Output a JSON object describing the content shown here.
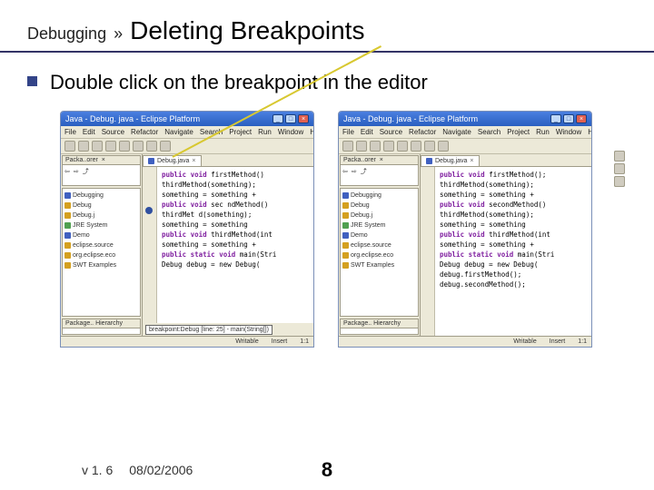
{
  "breadcrumb": "Debugging",
  "separator": "»",
  "title": "Deleting Breakpoints",
  "bullet": "Double click on the breakpoint in the editor",
  "footer": {
    "version": "v 1. 6",
    "date": "08/02/2006",
    "page": "8"
  },
  "ide": {
    "window_title": "Java - Debug. java - Eclipse Platform",
    "menus": [
      "File",
      "Edit",
      "Source",
      "Refactor",
      "Navigate",
      "Search",
      "Project",
      "Run",
      "Window",
      "Help"
    ],
    "left_tab_a": "Packa..orer",
    "editor_tab": "Debug.java",
    "editor_x": "×",
    "tree": [
      {
        "icon": "blue",
        "label": "Debugging"
      },
      {
        "icon": "",
        "label": "Debug"
      },
      {
        "icon": "",
        "label": "Debug.j"
      },
      {
        "icon": "green",
        "label": "JRE System"
      },
      {
        "icon": "blue",
        "label": "Demo"
      },
      {
        "icon": "",
        "label": "eclipse.source"
      },
      {
        "icon": "",
        "label": "org.eclipse.eco"
      },
      {
        "icon": "",
        "label": "SWT Examples"
      }
    ],
    "code_before": [
      [
        "public void",
        " firstMethod()"
      ],
      [
        "",
        "    thirdMethod(something);"
      ],
      [
        "",
        "    something = something +"
      ],
      [
        "",
        ""
      ],
      [
        "public void",
        " sec  ndMethod()"
      ],
      [
        "",
        "    thirdMet  d(something);"
      ],
      [
        "",
        "    something = something "
      ],
      [
        "",
        ""
      ],
      [
        "public void",
        " thirdMethod(int"
      ],
      [
        "",
        "    something = something +"
      ],
      [
        "",
        ""
      ],
      [
        "public static void",
        " main(Stri"
      ],
      [
        "",
        "    Debug debug = new Debug("
      ]
    ],
    "code_after": [
      [
        "public void",
        " firstMethod();"
      ],
      [
        "",
        "    thirdMethod(something);"
      ],
      [
        "",
        "    something = something +"
      ],
      [
        "",
        ""
      ],
      [
        "public void",
        " secondMethod()"
      ],
      [
        "",
        "    thirdMethod(something);"
      ],
      [
        "",
        "    something = something "
      ],
      [
        "",
        ""
      ],
      [
        "public void",
        " thirdMethod(int"
      ],
      [
        "",
        "    something = something +"
      ],
      [
        "",
        ""
      ],
      [
        "public static void",
        " main(Stri"
      ],
      [
        "",
        "    Debug debug = new Debug("
      ],
      [
        "",
        "    debug.firstMethod();"
      ],
      [
        "",
        "    debug.secondMethod();"
      ]
    ],
    "suggestion": "breakpoint:Debug [line: 25] - main(String[])",
    "status": {
      "left": "Package..  Hierarchy",
      "writable": "Writable",
      "insert": "Insert",
      "pos": "1:1"
    }
  }
}
